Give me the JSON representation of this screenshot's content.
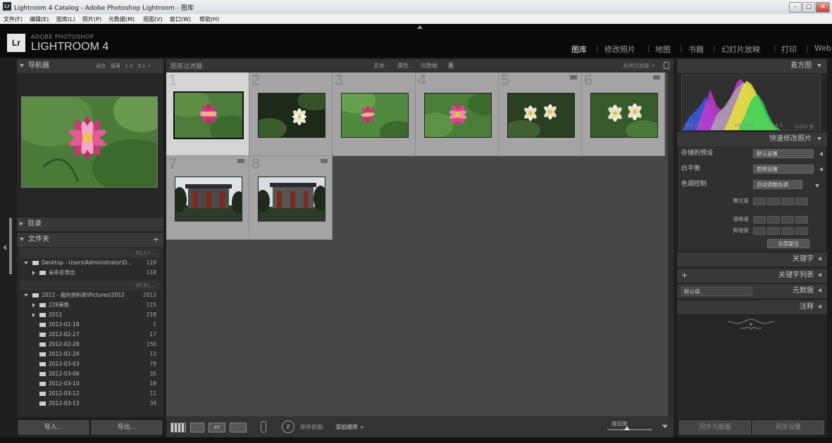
{
  "window": {
    "title": "Lightroom 4 Catalog - Adobe Photoshop Lightroom - 图库",
    "app_icon": "Lr",
    "controls": [
      "–",
      "□",
      "✕"
    ]
  },
  "menu": [
    "文件(F)",
    "编辑(E)",
    "图库(L)",
    "照片(P)",
    "元数据(M)",
    "视图(V)",
    "窗口(W)",
    "帮助(H)"
  ],
  "brand": {
    "logo": "Lr",
    "sub": "ADOBE PHOTOSHOP",
    "main": "LIGHTROOM 4"
  },
  "modules": [
    {
      "label": "图库",
      "active": true
    },
    {
      "label": "修改照片",
      "active": false
    },
    {
      "label": "地图",
      "active": false
    },
    {
      "label": "书籍",
      "active": false
    },
    {
      "label": "幻灯片放映",
      "active": false
    },
    {
      "label": "打印",
      "active": false
    },
    {
      "label": "Web",
      "active": false
    }
  ],
  "navigator": {
    "title": "导航器",
    "zoom_options": [
      "适合",
      "填满",
      "1:1",
      "3:1"
    ]
  },
  "catalog": {
    "title": "目录"
  },
  "folders": {
    "title": "文件夹",
    "add": "+",
    "volumes": [
      {
        "label": "",
        "capacity": "32.2 / …",
        "rows": [
          {
            "name": "Desktop - Users\\Administrator\\D...",
            "count": "119",
            "expanded": true,
            "indent": 0
          },
          {
            "name": "未命名导出",
            "count": "118",
            "expanded": false,
            "indent": 1
          }
        ]
      },
      {
        "label": "",
        "capacity": "35.9 / …",
        "rows": [
          {
            "name": "2012 - 我的资料库\\Pictures\\2012",
            "count": "2813",
            "expanded": true,
            "indent": 0
          },
          {
            "name": "228美影",
            "count": "115",
            "expanded": false,
            "indent": 1
          },
          {
            "name": "2012",
            "count": "218",
            "expanded": false,
            "indent": 1
          },
          {
            "name": "2012-02-18",
            "count": "1",
            "indent": 1
          },
          {
            "name": "2012-02-27",
            "count": "17",
            "indent": 1
          },
          {
            "name": "2012-02-28",
            "count": "150",
            "indent": 1
          },
          {
            "name": "2012-02-29",
            "count": "13",
            "indent": 1
          },
          {
            "name": "2012-03-03",
            "count": "79",
            "indent": 1
          },
          {
            "name": "2012-03-06",
            "count": "35",
            "indent": 1
          },
          {
            "name": "2012-03-10",
            "count": "18",
            "indent": 1
          },
          {
            "name": "2012-03-12",
            "count": "11",
            "indent": 1
          },
          {
            "name": "2012-03-13",
            "count": "34",
            "indent": 1
          }
        ]
      }
    ]
  },
  "left_buttons": {
    "import": "导入...",
    "export": "导出..."
  },
  "filter_bar": {
    "title": "图库过滤器:",
    "options": [
      "文本",
      "属性",
      "元数据",
      "无"
    ],
    "active": "无",
    "custom": "关闭过滤器 ÷"
  },
  "grid": {
    "cells": [
      {
        "num": "1",
        "subject": "lotus-pink",
        "selected": true
      },
      {
        "num": "2",
        "subject": "lotus-white-dark",
        "selected": false
      },
      {
        "num": "3",
        "subject": "lotus-pink-small",
        "selected": false
      },
      {
        "num": "4",
        "subject": "lotus-pink-bloom",
        "selected": false
      },
      {
        "num": "5",
        "subject": "lotus-white-pair",
        "selected": false
      },
      {
        "num": "6",
        "subject": "lotus-white-pair",
        "selected": false
      },
      {
        "num": "7",
        "subject": "building-gate",
        "selected": false
      },
      {
        "num": "8",
        "subject": "building-gate",
        "selected": false
      }
    ]
  },
  "toolbar": {
    "sort_label": "排序依据:",
    "sort_value": "添加顺序 ÷",
    "thumbnail_label": "缩览图"
  },
  "histogram": {
    "title": "直方图",
    "iso": "ISO 250",
    "focal": "180 mm",
    "aperture": "f / 6.3",
    "shutter": "1/320 秒"
  },
  "quick_develop": {
    "title": "快速修改照片",
    "saved_preset_label": "存储的预设",
    "saved_preset_value": "默认设置",
    "white_balance_label": "白平衡",
    "white_balance_value": "原照设置",
    "tone_label": "色调控制",
    "auto_tone": "自动调整色调",
    "exposure": "曝光度",
    "clarity": "清晰度",
    "vibrance": "鲜艳度",
    "reset_all": "全部复位"
  },
  "right_panels": {
    "keywording": "关键字",
    "keyword_list": "关键字列表",
    "keyword_add": "+",
    "metadata": "元数据",
    "metadata_preset": "默认值",
    "comments": "注释"
  },
  "right_buttons": {
    "sync_meta": "同步元数据",
    "sync_settings": "同步设置"
  },
  "colors": {
    "bg": "#1e1e1e",
    "panel": "#2b2b2b",
    "grid": "#474747",
    "cell": "#a4a4a4",
    "selected_cell": "#d4d4d4"
  }
}
